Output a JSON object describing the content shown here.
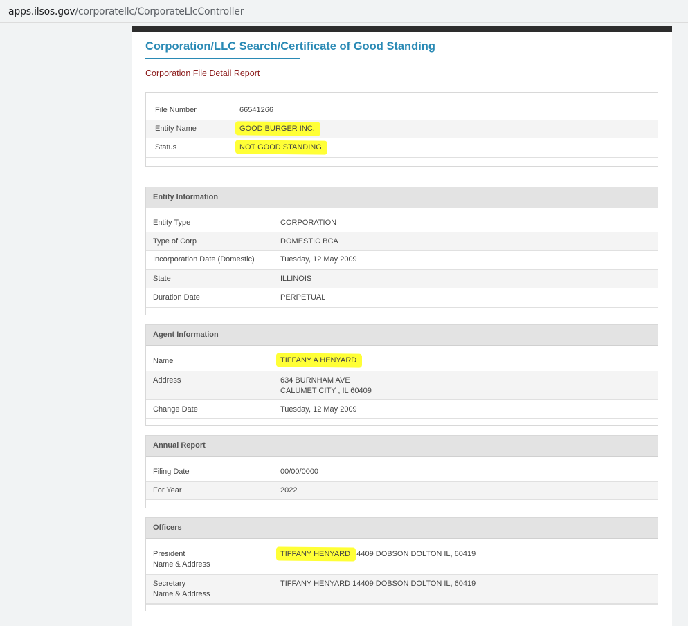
{
  "browser": {
    "url_host": "apps.ilsos.gov",
    "url_path": "/corporatellc/CorporateLlcController"
  },
  "page": {
    "title": "Corporation/LLC Search/Certificate of Good Standing",
    "subtitle": "Corporation File Detail Report"
  },
  "summary": {
    "file_number_label": "File Number",
    "file_number": "66541266",
    "entity_name_label": "Entity Name",
    "entity_name": "GOOD BURGER INC.",
    "status_label": "Status",
    "status": "NOT GOOD STANDING"
  },
  "entity_info": {
    "heading": "Entity Information",
    "rows": [
      {
        "label": "Entity Type",
        "value": "CORPORATION"
      },
      {
        "label": "Type of Corp",
        "value": "DOMESTIC BCA"
      },
      {
        "label": "Incorporation Date (Domestic)",
        "value": "Tuesday, 12 May 2009"
      },
      {
        "label": "State",
        "value": "ILLINOIS"
      },
      {
        "label": "Duration Date",
        "value": "PERPETUAL"
      }
    ]
  },
  "agent_info": {
    "heading": "Agent Information",
    "name_label": "Name",
    "name": "TIFFANY A HENYARD",
    "address_label": "Address",
    "address_line1": "634 BURNHAM AVE",
    "address_line2": "CALUMET CITY , IL 60409",
    "change_date_label": "Change Date",
    "change_date": "Tuesday, 12 May 2009"
  },
  "annual_report": {
    "heading": "Annual Report",
    "filing_date_label": "Filing Date",
    "filing_date": "00/00/0000",
    "for_year_label": "For Year",
    "for_year": "2022"
  },
  "officers": {
    "heading": "Officers",
    "president_label_1": "President",
    "president_label_2": "Name & Address",
    "president_name": "TIFFANY HENYARD",
    "president_address": " 14409 DOBSON DOLTON IL, 60419",
    "secretary_label_1": "Secretary",
    "secretary_label_2": "Name & Address",
    "secretary_value": "TIFFANY HENYARD 14409 DOBSON DOLTON IL, 60419"
  },
  "colors": {
    "title": "#2a8ab5",
    "subtitle": "#8b1a1a",
    "highlight": "#ffff36",
    "header_bar": "#2d2d2d"
  }
}
